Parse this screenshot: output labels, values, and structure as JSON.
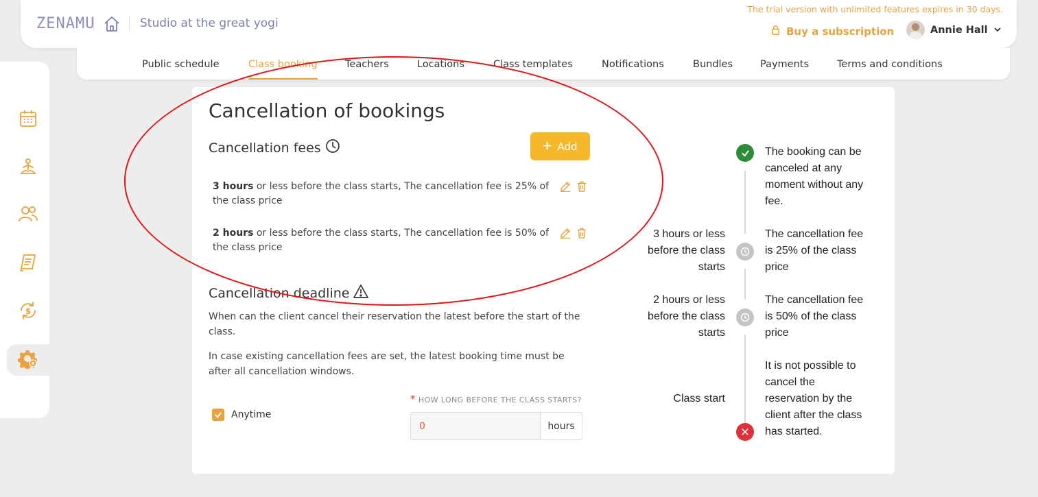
{
  "header": {
    "logo": "ZENAMU",
    "studio_name": "Studio at the great yogi",
    "trial_note": "The trial version with unlimited features expires in 30 days.",
    "buy_label": "Buy a subscription",
    "user_name": "Annie Hall"
  },
  "tabs": [
    {
      "label": "Public schedule",
      "active": false
    },
    {
      "label": "Class booking",
      "active": true
    },
    {
      "label": "Teachers",
      "active": false
    },
    {
      "label": "Locations",
      "active": false
    },
    {
      "label": "Class templates",
      "active": false
    },
    {
      "label": "Notifications",
      "active": false
    },
    {
      "label": "Bundles",
      "active": false
    },
    {
      "label": "Payments",
      "active": false
    },
    {
      "label": "Terms and conditions",
      "active": false
    }
  ],
  "sidebar": {
    "items": [
      {
        "icon": "calendar-icon"
      },
      {
        "icon": "yoga-icon"
      },
      {
        "icon": "people-icon"
      },
      {
        "icon": "receipt-icon"
      },
      {
        "icon": "money-cycle-icon"
      },
      {
        "icon": "settings-gear-icon",
        "active": true
      }
    ]
  },
  "main": {
    "title": "Cancellation of bookings",
    "fees_heading": "Cancellation fees",
    "add_label": "Add",
    "fees": [
      {
        "hours": "3 hours",
        "text": " or less before the class starts, The cancellation fee is 25% of the class price"
      },
      {
        "hours": "2 hours",
        "text": " or less before the class starts, The cancellation fee is 50% of the class price"
      }
    ],
    "deadline_heading": "Cancellation deadline",
    "deadline_desc1": "When can the client cancel their reservation the latest before the start of the class.",
    "deadline_desc2": "In case existing cancellation fees are set, the latest booking time must be after all cancellation windows.",
    "anytime_label": "Anytime",
    "anytime_checked": true,
    "field_label": "HOW LONG BEFORE THE CLASS STARTS?",
    "field_value": "0",
    "field_unit": "hours"
  },
  "timeline": [
    {
      "left": "",
      "right": "The booking can be canceled at any moment without any fee.",
      "status": "ok"
    },
    {
      "left": "3 hours or less before the class starts",
      "right": "The cancellation fee is 25% of the class price",
      "status": "fee"
    },
    {
      "left": "2 hours or less before the class starts",
      "right": "The cancellation fee is 50% of the class price",
      "status": "fee"
    },
    {
      "left": "Class start",
      "right": "It is not possible to cancel the reservation by the client after the class has started.",
      "status": "blocked"
    }
  ],
  "colors": {
    "accent": "#e8a33c",
    "add_button": "#f5b82a",
    "header_text": "#7c80ad",
    "ok": "#2e8b3a",
    "fee": "#c4c4c4",
    "blocked": "#e0313a",
    "annotation": "#e01515"
  }
}
